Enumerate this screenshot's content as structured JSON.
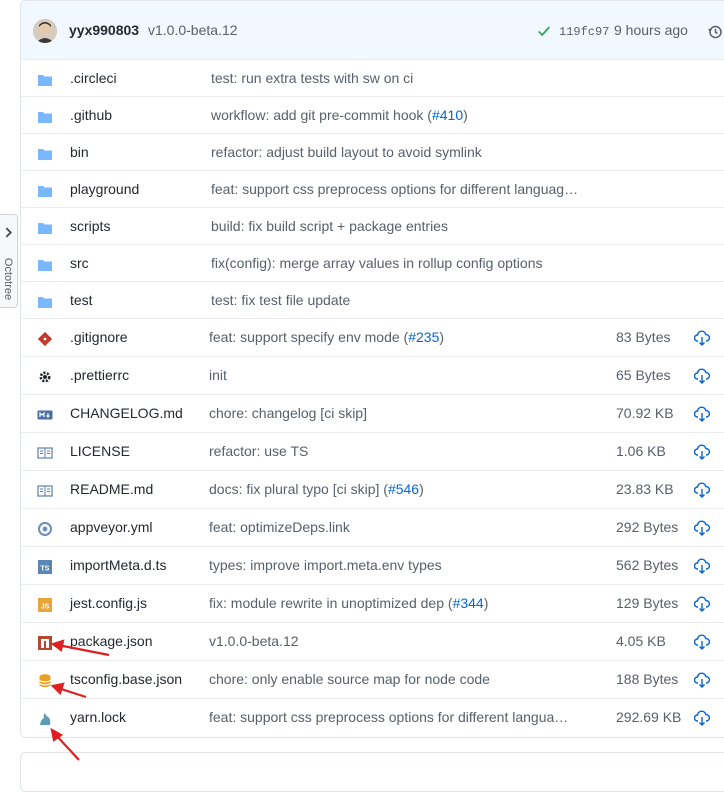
{
  "commit": {
    "author": "yyx990803",
    "message": "v1.0.0-beta.12",
    "sha": "119fc97",
    "age": "9 hours ago"
  },
  "octotree": {
    "label": "Octotree"
  },
  "files": [
    {
      "name": ".circleci",
      "type": "dir",
      "icon": "folder-icon",
      "msg": "test: run extra tests with sw on ci",
      "size": ""
    },
    {
      "name": ".github",
      "type": "dir",
      "icon": "folder-icon",
      "msg": "workflow: add git pre-commit hook (",
      "link": "#410",
      "msg_after": ")",
      "size": ""
    },
    {
      "name": "bin",
      "type": "dir",
      "icon": "folder-icon",
      "msg": "refactor: adjust build layout to avoid symlink",
      "size": ""
    },
    {
      "name": "playground",
      "type": "dir",
      "icon": "folder-icon",
      "msg": "feat: support css preprocess options for different languag…",
      "size": ""
    },
    {
      "name": "scripts",
      "type": "dir",
      "icon": "folder-icon",
      "msg": "build: fix build script + package entries",
      "size": ""
    },
    {
      "name": "src",
      "type": "dir",
      "icon": "folder-icon",
      "msg": "fix(config): merge array values in rollup config options",
      "size": ""
    },
    {
      "name": "test",
      "type": "dir",
      "icon": "folder-icon",
      "msg": "test: fix test file update",
      "size": ""
    },
    {
      "name": ".gitignore",
      "type": "file",
      "icon": "git-icon",
      "msg": "feat: support specify env mode (",
      "link": "#235",
      "msg_after": ")",
      "size": "83 Bytes"
    },
    {
      "name": ".prettierrc",
      "type": "file",
      "icon": "gear-icon",
      "msg": "init",
      "size": "65 Bytes"
    },
    {
      "name": "CHANGELOG.md",
      "type": "file",
      "icon": "markdown-icon",
      "msg": "chore: changelog [ci skip]",
      "size": "70.92 KB"
    },
    {
      "name": "LICENSE",
      "type": "file",
      "icon": "book-icon",
      "msg": "refactor: use TS",
      "size": "1.06 KB"
    },
    {
      "name": "README.md",
      "type": "file",
      "icon": "book-icon",
      "msg": "docs: fix plural typo [ci skip] (",
      "link": "#546",
      "msg_after": ")",
      "size": "23.83 KB"
    },
    {
      "name": "appveyor.yml",
      "type": "file",
      "icon": "appveyor-icon",
      "msg": "feat: optimizeDeps.link",
      "size": "292 Bytes"
    },
    {
      "name": "importMeta.d.ts",
      "type": "file",
      "icon": "typescript-icon",
      "msg": "types: improve import.meta.env types",
      "size": "562 Bytes"
    },
    {
      "name": "jest.config.js",
      "type": "file",
      "icon": "javascript-icon",
      "msg": "fix: module rewrite in unoptimized dep (",
      "link": "#344",
      "msg_after": ")",
      "size": "129 Bytes"
    },
    {
      "name": "package.json",
      "type": "file",
      "icon": "npm-icon",
      "msg": "v1.0.0-beta.12",
      "size": "4.05 KB"
    },
    {
      "name": "tsconfig.base.json",
      "type": "file",
      "icon": "database-icon",
      "msg": "chore: only enable source map for node code",
      "size": "188 Bytes"
    },
    {
      "name": "yarn.lock",
      "type": "file",
      "icon": "yarn-icon",
      "msg": "feat: support css preprocess options for different langua…",
      "size": "292.69 KB"
    }
  ],
  "colors": {
    "folder": "#79b8ff",
    "link": "#0366d6",
    "check": "#28a745",
    "download": "#0366d6",
    "annotation_arrow": "#e02020"
  }
}
